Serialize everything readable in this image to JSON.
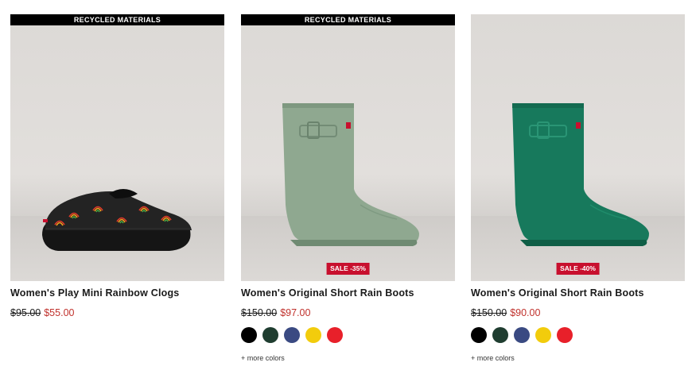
{
  "products": [
    {
      "tag": "RECYCLED MATERIALS",
      "title": "Women's Play Mini Rainbow Clogs",
      "price_original": "$95.00",
      "price_sale": "$55.00",
      "sale_badge": "",
      "swatches": [],
      "more_colors": ""
    },
    {
      "tag": "RECYCLED MATERIALS",
      "title": "Women's Original Short Rain Boots",
      "price_original": "$150.00",
      "price_sale": "$97.00",
      "sale_badge": "SALE -35%",
      "swatches": [
        "#000000",
        "#1f3d30",
        "#3a4a82",
        "#f2cc0c",
        "#e8202a"
      ],
      "more_colors": "+ more colors"
    },
    {
      "tag": "",
      "title": "Women's Original Short Rain Boots",
      "price_original": "$150.00",
      "price_sale": "$90.00",
      "sale_badge": "SALE -40%",
      "swatches": [
        "#000000",
        "#1f3d30",
        "#3a4a82",
        "#f2cc0c",
        "#e8202a"
      ],
      "more_colors": "+ more colors"
    }
  ],
  "colors": {
    "sale_price": "#c0312c",
    "sale_badge_bg": "#c8102e",
    "tag_bg": "#000000",
    "boot_sage": "#8fa890",
    "boot_teal": "#17795c",
    "clog_body": "#1e1e1e"
  }
}
